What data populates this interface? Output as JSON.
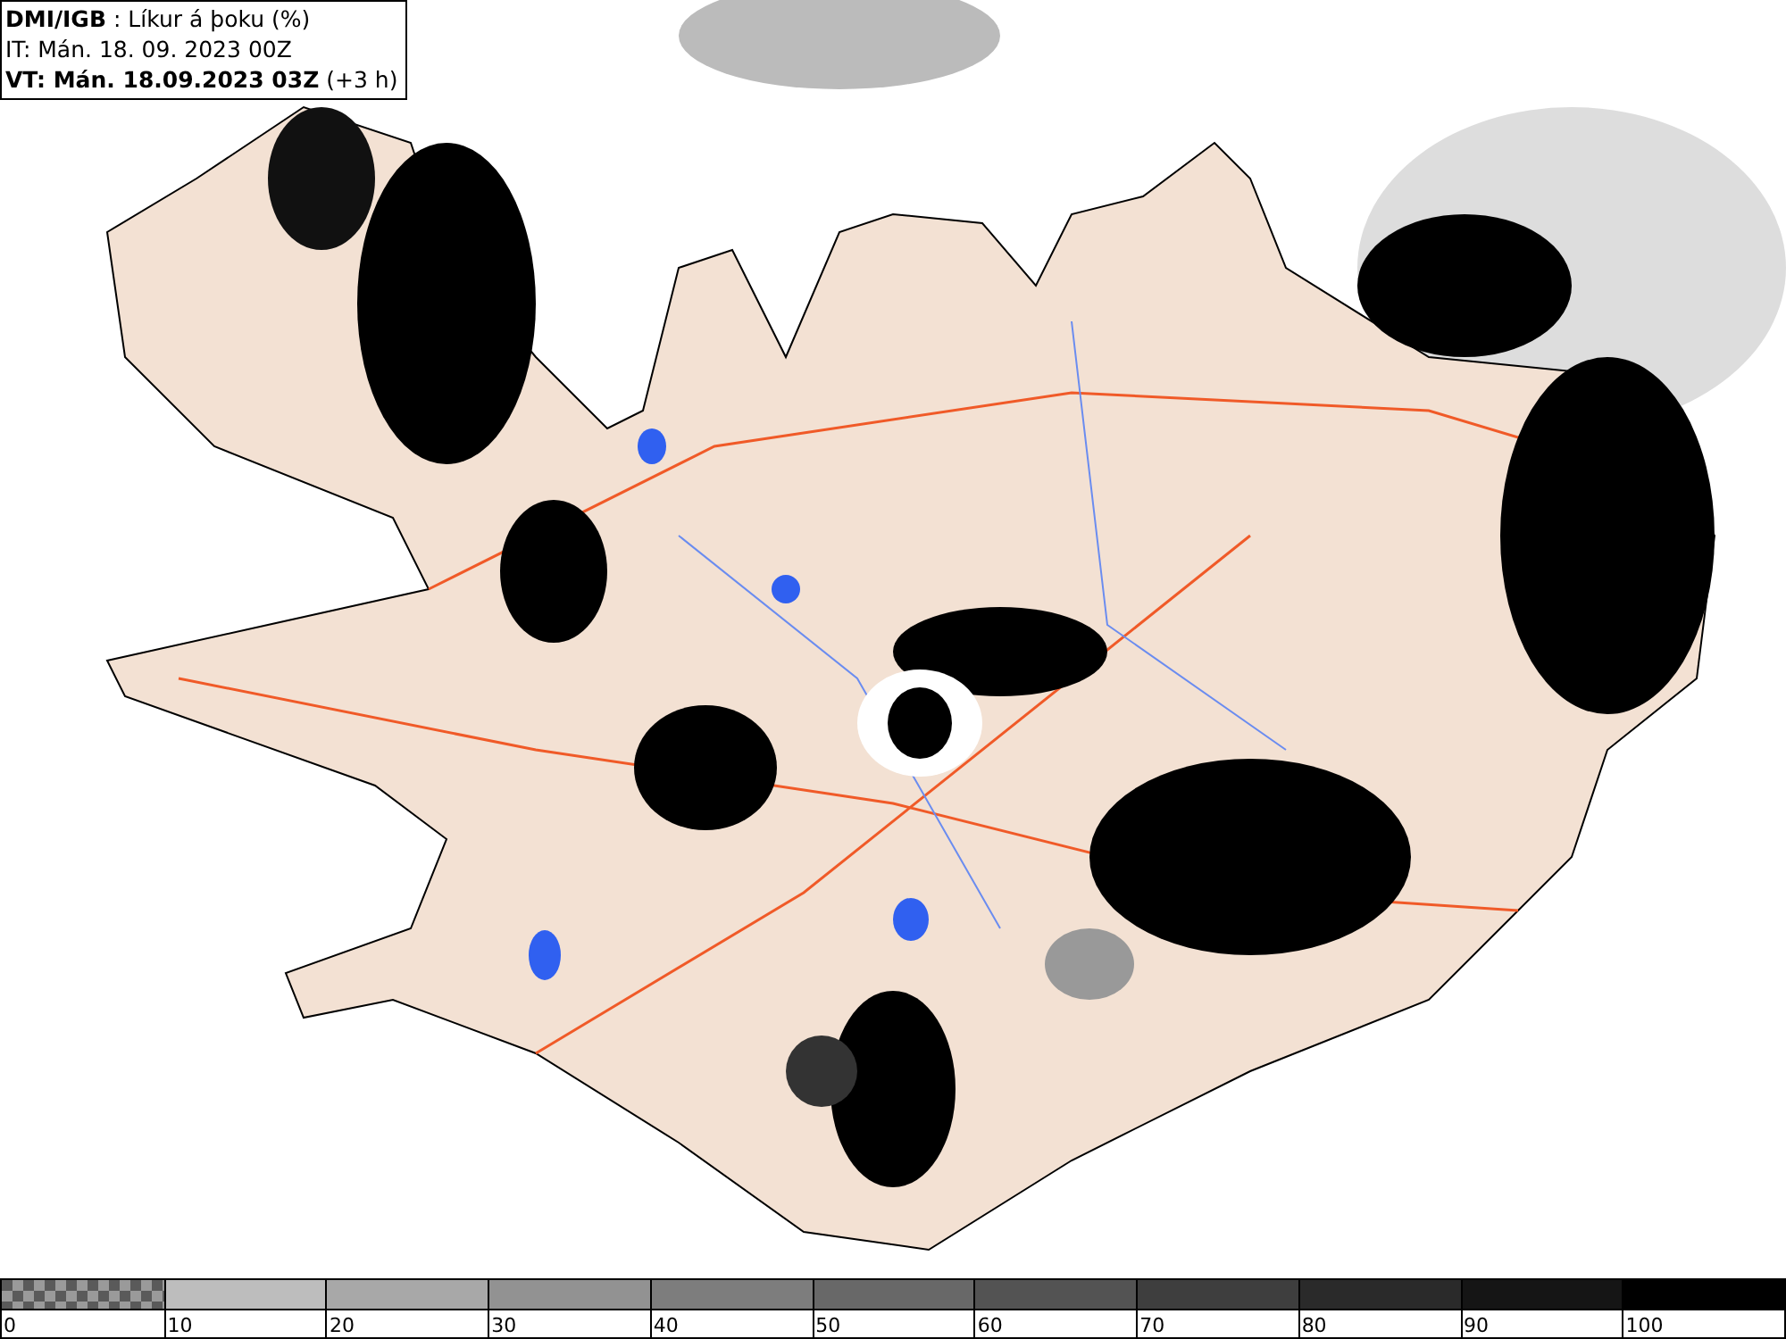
{
  "header": {
    "source": "DMI/IGB",
    "title": ": Líkur á þoku (%)",
    "issue_time": "IT: Mán. 18. 09. 2023 00Z",
    "valid_time": "VT: Mán. 18.09.2023 03Z",
    "valid_offset": "(+3 h)"
  },
  "legend": [
    {
      "kind": "checker",
      "label": "0"
    },
    {
      "kind": "solid",
      "color": "#bdbdbd",
      "label": "10"
    },
    {
      "kind": "solid",
      "color": "#a8a8a8",
      "label": "20"
    },
    {
      "kind": "solid",
      "color": "#929292",
      "label": "30"
    },
    {
      "kind": "solid",
      "color": "#7d7d7d",
      "label": "40"
    },
    {
      "kind": "solid",
      "color": "#686868",
      "label": "50"
    },
    {
      "kind": "solid",
      "color": "#535353",
      "label": "60"
    },
    {
      "kind": "solid",
      "color": "#3e3e3e",
      "label": "70"
    },
    {
      "kind": "solid",
      "color": "#2a2a2a",
      "label": "80"
    },
    {
      "kind": "solid",
      "color": "#151515",
      "label": "90"
    },
    {
      "kind": "solid",
      "color": "#000000",
      "label": "100"
    }
  ]
}
